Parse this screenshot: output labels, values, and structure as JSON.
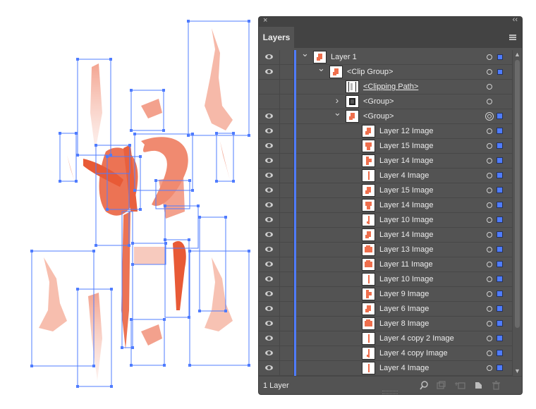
{
  "panel": {
    "close_glyph": "×",
    "collapse_glyph": "‹‹",
    "tab_label": "Layers",
    "menu_icon": "panel-menu-icon",
    "footer_count": "1 Layer",
    "footer_icons": [
      "locate-object-icon",
      "make-clipping-mask-icon",
      "create-sublayer-icon",
      "new-layer-icon",
      "delete-icon"
    ]
  },
  "accent_color": "#4f7cff",
  "paint_color": "#ef6f4d",
  "layers": [
    {
      "label": "Layer 1"
    },
    {
      "label": "<Clip Group>"
    },
    {
      "label": "<Clipping Path>"
    },
    {
      "label": "<Group>"
    },
    {
      "label": "<Group>"
    },
    {
      "label": "Layer 12 Image"
    },
    {
      "label": "Layer 15 Image"
    },
    {
      "label": "Layer 14 Image"
    },
    {
      "label": "Layer 4 Image"
    },
    {
      "label": "Layer 15 Image"
    },
    {
      "label": "Layer 14 Image"
    },
    {
      "label": "Layer 10 Image"
    },
    {
      "label": "Layer 14 Image"
    },
    {
      "label": "Layer 13 Image"
    },
    {
      "label": "Layer 11 Image"
    },
    {
      "label": "Layer 10 Image"
    },
    {
      "label": "Layer 9 Image"
    },
    {
      "label": "Layer 6 Image"
    },
    {
      "label": "Layer 8 Image"
    },
    {
      "label": "Layer 4 copy 2 Image"
    },
    {
      "label": "Layer 4 copy Image"
    },
    {
      "label": "Layer 4 Image"
    }
  ]
}
